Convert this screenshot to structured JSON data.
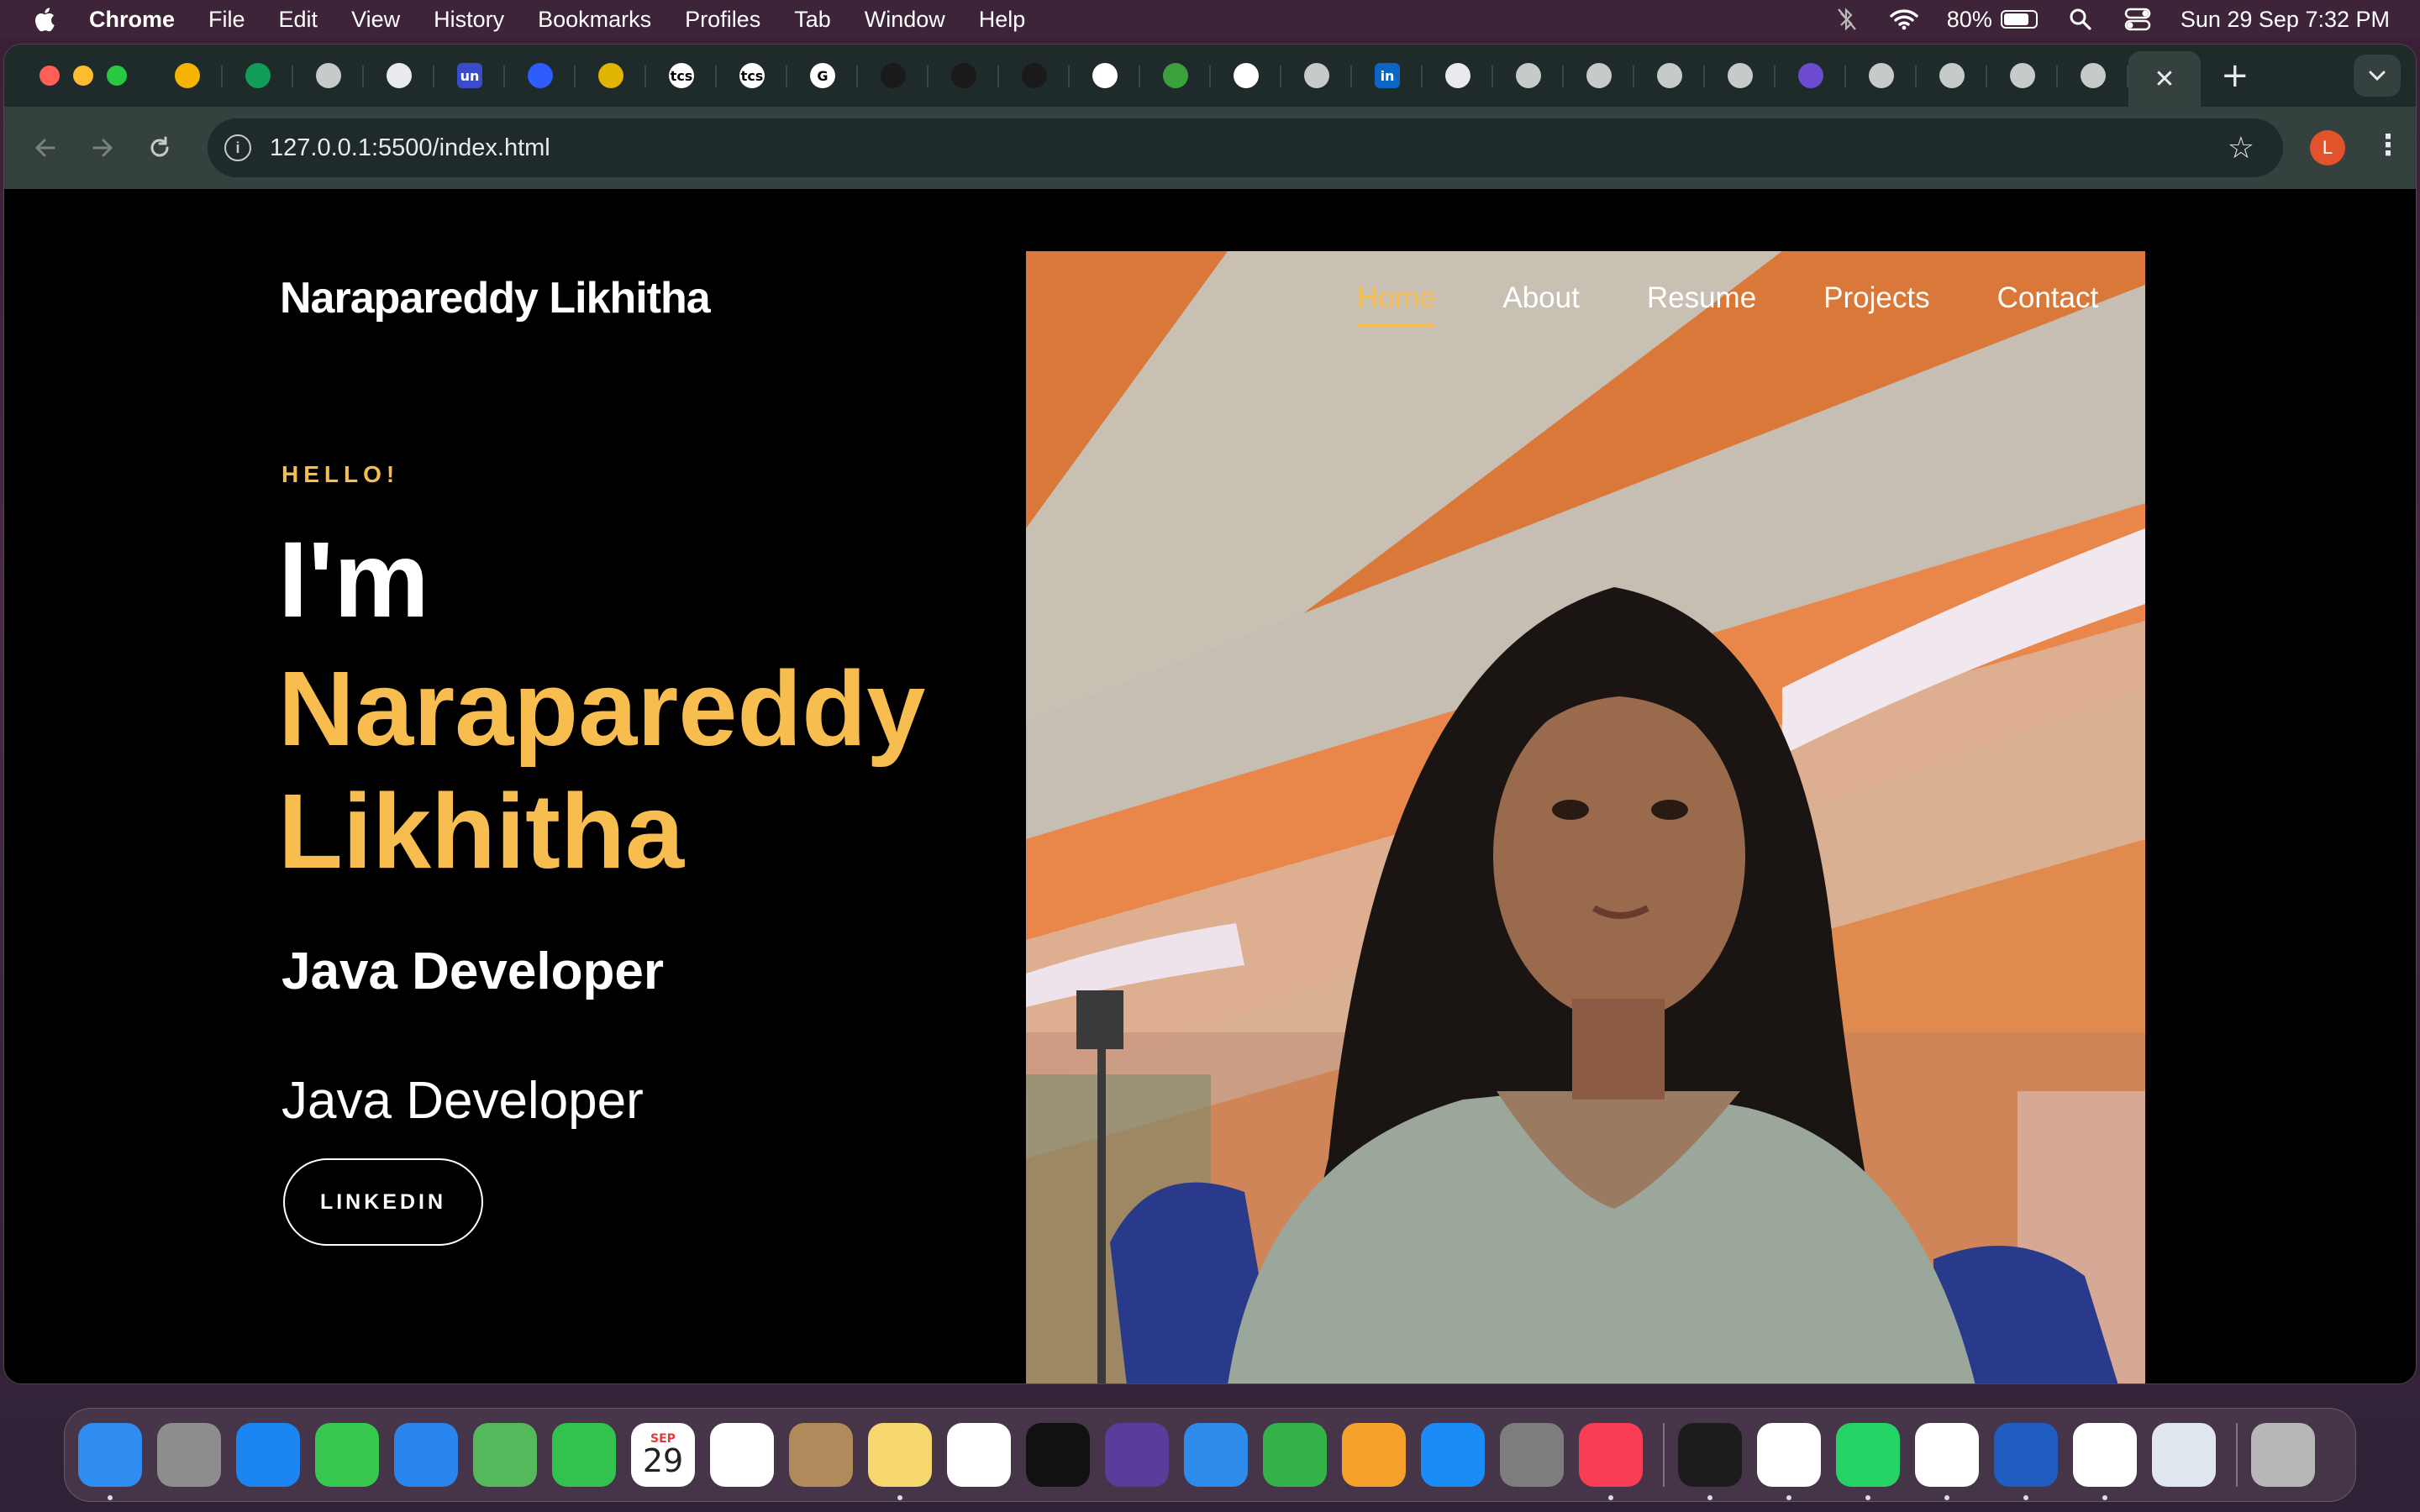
{
  "menubar": {
    "app_name": "Chrome",
    "items": [
      "File",
      "Edit",
      "View",
      "History",
      "Bookmarks",
      "Profiles",
      "Tab",
      "Window",
      "Help"
    ],
    "battery_percent": "80%",
    "battery_level": 0.8,
    "datetime": "Sun 29 Sep  7:32 PM"
  },
  "browser": {
    "url": "127.0.0.1:5500/index.html",
    "profile_initial": "L",
    "tabs": [
      {
        "icon": "google-drive-icon",
        "color": "#f4b400"
      },
      {
        "icon": "google-drive-icon",
        "color": "#0f9d58"
      },
      {
        "icon": "chrome-icon",
        "color": "#c6cbc9"
      },
      {
        "icon": "cisco-icon",
        "color": "#e8eaed"
      },
      {
        "icon": "unstop-icon",
        "color": "#3b4cca",
        "text": "un"
      },
      {
        "icon": "app-icon",
        "color": "#2e5cff"
      },
      {
        "icon": "app-icon",
        "color": "#e0b400"
      },
      {
        "icon": "tcs-icon",
        "color": "#ffffff",
        "text": "tcs"
      },
      {
        "icon": "tcs-icon",
        "color": "#ffffff",
        "text": "tcs"
      },
      {
        "icon": "google-icon",
        "color": "#ffffff",
        "text": "G"
      },
      {
        "icon": "chatgpt-icon",
        "color": "#1a1a1a"
      },
      {
        "icon": "chatgpt-icon",
        "color": "#1a1a1a"
      },
      {
        "icon": "chatgpt-icon",
        "color": "#1a1a1a"
      },
      {
        "icon": "github-icon",
        "color": "#ffffff"
      },
      {
        "icon": "app-icon",
        "color": "#3ca03c"
      },
      {
        "icon": "github-icon",
        "color": "#ffffff"
      },
      {
        "icon": "globe-icon",
        "color": "#c6cbc9"
      },
      {
        "icon": "linkedin-icon",
        "color": "#0a66c2",
        "text": "in"
      },
      {
        "icon": "app-icon",
        "color": "#e8eaed"
      },
      {
        "icon": "globe-icon",
        "color": "#c6cbc9"
      },
      {
        "icon": "globe-icon",
        "color": "#c6cbc9"
      },
      {
        "icon": "globe-icon",
        "color": "#c6cbc9"
      },
      {
        "icon": "globe-icon",
        "color": "#c6cbc9"
      },
      {
        "icon": "list-icon",
        "color": "#6d4cd1"
      },
      {
        "icon": "globe-icon",
        "color": "#c6cbc9"
      },
      {
        "icon": "globe-icon",
        "color": "#c6cbc9"
      },
      {
        "icon": "globe-icon",
        "color": "#c6cbc9"
      },
      {
        "icon": "globe-icon",
        "color": "#c6cbc9"
      }
    ]
  },
  "site": {
    "brand": "Narapareddy Likhitha",
    "nav": [
      "Home",
      "About",
      "Resume",
      "Projects",
      "Contact"
    ],
    "hello": "HELLO!",
    "im": "I'm",
    "name": "Narapareddy Likhitha",
    "role_bold": "Java Developer",
    "role_light": "Java Developer",
    "cta": "LINKEDIN",
    "accent_color": "#f7be4f"
  },
  "dock": {
    "calendar_month": "SEP",
    "calendar_day": "29",
    "apps": [
      {
        "name": "finder-icon",
        "color": "#2f8cf0"
      },
      {
        "name": "launchpad-icon",
        "color": "#8d8d8d"
      },
      {
        "name": "safari-icon",
        "color": "#1b86f2"
      },
      {
        "name": "messages-icon",
        "color": "#37c84f"
      },
      {
        "name": "mail-icon",
        "color": "#2a86ee"
      },
      {
        "name": "maps-icon",
        "color": "#55b85a"
      },
      {
        "name": "facetime-icon",
        "color": "#33c24d"
      },
      {
        "name": "calendar-icon",
        "color": "#ffffff"
      },
      {
        "name": "reminders-icon",
        "color": "#ffffff"
      },
      {
        "name": "contacts-icon",
        "color": "#b08a5a"
      },
      {
        "name": "notes-icon",
        "color": "#f5d76e"
      },
      {
        "name": "freeform-icon",
        "color": "#ffffff"
      },
      {
        "name": "tv-icon",
        "color": "#111111"
      },
      {
        "name": "siri-icon",
        "color": "#5a3c9a"
      },
      {
        "name": "keynote-icon",
        "color": "#2e8bea"
      },
      {
        "name": "numbers-icon",
        "color": "#34b34a"
      },
      {
        "name": "pages-icon",
        "color": "#f5a12b"
      },
      {
        "name": "app-store-icon",
        "color": "#1b8cf5"
      },
      {
        "name": "system-settings-icon",
        "color": "#7d7d7d"
      },
      {
        "name": "music-icon",
        "color": "#fa3c54"
      },
      {
        "name": "terminal-icon",
        "color": "#1c1c1c"
      },
      {
        "name": "chrome-icon",
        "color": "#ffffff"
      },
      {
        "name": "whatsapp-icon",
        "color": "#25d366"
      },
      {
        "name": "vscode-icon",
        "color": "#ffffff"
      },
      {
        "name": "word-icon",
        "color": "#1f5cbf"
      },
      {
        "name": "vscode-icon",
        "color": "#ffffff"
      },
      {
        "name": "preview-icon",
        "color": "#dfe6ee"
      },
      {
        "name": "trash-icon",
        "color": "#b7b7b7"
      }
    ]
  }
}
